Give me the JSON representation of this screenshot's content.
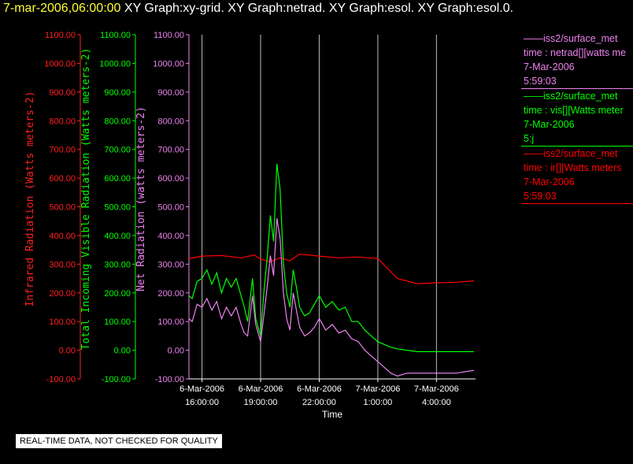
{
  "header": {
    "timestamp": "7-mar-2006,06:00:00",
    "graphs": "XY Graph:xy-grid.  XY Graph:netrad.  XY Graph:esol.  XY Graph:esol.0."
  },
  "legend": [
    {
      "source": "iss2/surface_met",
      "field": "time : netrad[][watts me",
      "date": "7-Mar-2006",
      "time": "5:59:03",
      "color": "#ee82ee"
    },
    {
      "source": "iss2/surface_met",
      "field": "time : vis[][Watts meter",
      "date": "7-Mar-2006",
      "time": "5:j",
      "color": "#00ff00"
    },
    {
      "source": "iss2/surface_met",
      "field": "time : ir[][Watts meters",
      "date": "7-Mar-2006",
      "time": "5:59:03",
      "color": "#ff0000"
    }
  ],
  "footer": {
    "quality_note": "REAL-TIME DATA, NOT CHECKED FOR QUALITY"
  },
  "chart_data": {
    "type": "line",
    "xlabel": "Time",
    "x_ticks": [
      {
        "x": "16:00",
        "date": "6-Mar-2006",
        "time": "16:00:00"
      },
      {
        "x": "19:00",
        "date": "6-Mar-2006",
        "time": "19:00:00"
      },
      {
        "x": "22:00",
        "date": "6-Mar-2006",
        "time": "22:00:00"
      },
      {
        "x": "01:00",
        "date": "7-Mar-2006",
        "time": "1:00:00"
      },
      {
        "x": "04:00",
        "date": "7-Mar-2006",
        "time": "4:00:00"
      }
    ],
    "x_range": [
      "6-Mar-2006 15:20",
      "7-Mar-2006 06:00"
    ],
    "grid": "vertical lines at x ticks",
    "axes": [
      {
        "id": "ir",
        "label": "Infrared Radiation (Watts meters-2)",
        "color": "#ff2020",
        "ylim": [
          -100,
          1100
        ],
        "ticks": [
          "-100.00",
          "0.00",
          "100.00",
          "200.00",
          "300.00",
          "400.00",
          "500.00",
          "600.00",
          "700.00",
          "800.00",
          "900.00",
          "1000.00",
          "1100.00"
        ]
      },
      {
        "id": "vis",
        "label": "Total Incoming Visible Radiation (Watts meters-2)",
        "color": "#00ff00",
        "ylim": [
          -100,
          1100
        ],
        "ticks": [
          "-100.00",
          "0.00",
          "100.00",
          "200.00",
          "300.00",
          "400.00",
          "500.00",
          "600.00",
          "700.00",
          "800.00",
          "900.00",
          "1000.00",
          "1100.00"
        ]
      },
      {
        "id": "net",
        "label": "Net Radiation (watts meters-2)",
        "color": "#ee82ee",
        "ylim": [
          -100,
          1100
        ],
        "ticks": [
          "-100.00",
          "0.00",
          "100.00",
          "200.00",
          "300.00",
          "400.00",
          "500.00",
          "600.00",
          "700.00",
          "800.00",
          "900.00",
          "1000.00",
          "1100.00"
        ]
      }
    ],
    "series": [
      {
        "name": "ir",
        "color": "#ff0000",
        "x": [
          "15:20",
          "16:00",
          "17:00",
          "18:00",
          "18:40",
          "19:00",
          "19:30",
          "20:00",
          "20:30",
          "21:00",
          "22:00",
          "23:00",
          "00:00",
          "00:30",
          "01:00",
          "01:30",
          "02:00",
          "03:00",
          "04:00",
          "05:00",
          "05:55"
        ],
        "values": [
          320,
          328,
          330,
          322,
          332,
          318,
          308,
          322,
          312,
          335,
          328,
          322,
          325,
          322,
          320,
          285,
          250,
          232,
          235,
          237,
          242
        ]
      },
      {
        "name": "vis",
        "color": "#00ff00",
        "x": [
          "15:20",
          "15:30",
          "15:45",
          "16:00",
          "16:15",
          "16:30",
          "16:45",
          "17:00",
          "17:15",
          "17:30",
          "17:45",
          "18:00",
          "18:10",
          "18:20",
          "18:35",
          "18:45",
          "19:00",
          "19:10",
          "19:20",
          "19:30",
          "19:40",
          "19:50",
          "20:00",
          "20:10",
          "20:20",
          "20:30",
          "20:40",
          "20:50",
          "21:00",
          "21:15",
          "21:30",
          "21:45",
          "22:00",
          "22:20",
          "22:40",
          "23:00",
          "23:20",
          "23:40",
          "00:00",
          "00:20",
          "00:40",
          "01:00",
          "01:20",
          "01:40",
          "02:00",
          "02:30",
          "03:00",
          "04:00",
          "05:00",
          "05:55"
        ],
        "values": [
          190,
          180,
          240,
          250,
          280,
          230,
          270,
          200,
          250,
          220,
          250,
          190,
          150,
          100,
          250,
          110,
          50,
          200,
          320,
          470,
          380,
          650,
          560,
          300,
          200,
          150,
          280,
          220,
          150,
          120,
          130,
          160,
          190,
          150,
          170,
          140,
          150,
          100,
          100,
          70,
          50,
          30,
          20,
          10,
          5,
          0,
          -5,
          -5,
          -5,
          -5
        ]
      },
      {
        "name": "net",
        "color": "#ee82ee",
        "x": [
          "15:20",
          "15:30",
          "15:45",
          "16:00",
          "16:15",
          "16:30",
          "16:45",
          "17:00",
          "17:15",
          "17:30",
          "17:45",
          "18:00",
          "18:10",
          "18:20",
          "18:35",
          "18:45",
          "19:00",
          "19:10",
          "19:20",
          "19:30",
          "19:40",
          "19:50",
          "20:00",
          "20:10",
          "20:20",
          "20:30",
          "20:40",
          "20:50",
          "21:00",
          "21:15",
          "21:30",
          "21:45",
          "22:00",
          "22:20",
          "22:40",
          "23:00",
          "23:20",
          "23:40",
          "00:00",
          "00:20",
          "00:40",
          "01:00",
          "01:20",
          "01:40",
          "02:00",
          "02:30",
          "03:00",
          "04:00",
          "05:00",
          "05:55"
        ],
        "values": [
          110,
          100,
          160,
          150,
          180,
          140,
          170,
          110,
          150,
          120,
          150,
          90,
          60,
          50,
          190,
          90,
          30,
          120,
          220,
          330,
          260,
          460,
          390,
          200,
          110,
          70,
          200,
          140,
          80,
          50,
          60,
          80,
          110,
          70,
          90,
          60,
          70,
          40,
          30,
          0,
          -20,
          -40,
          -60,
          -80,
          -90,
          -80,
          -80,
          -80,
          -80,
          -70
        ]
      }
    ]
  }
}
